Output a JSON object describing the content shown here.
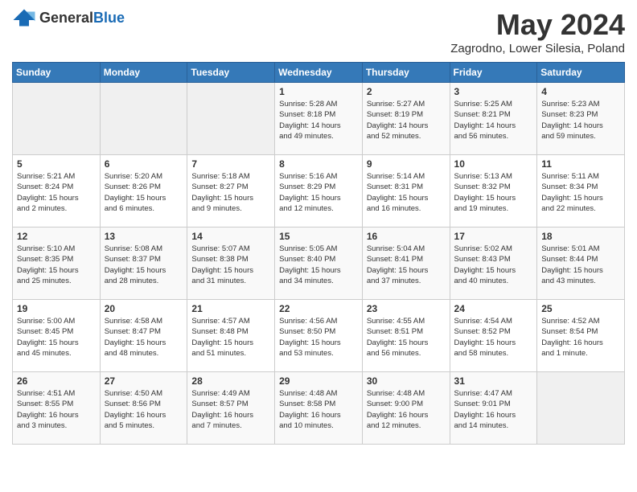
{
  "header": {
    "logo_general": "General",
    "logo_blue": "Blue",
    "month_title": "May 2024",
    "subtitle": "Zagrodno, Lower Silesia, Poland"
  },
  "days_of_week": [
    "Sunday",
    "Monday",
    "Tuesday",
    "Wednesday",
    "Thursday",
    "Friday",
    "Saturday"
  ],
  "weeks": [
    [
      {
        "day": "",
        "info": ""
      },
      {
        "day": "",
        "info": ""
      },
      {
        "day": "",
        "info": ""
      },
      {
        "day": "1",
        "info": "Sunrise: 5:28 AM\nSunset: 8:18 PM\nDaylight: 14 hours\nand 49 minutes."
      },
      {
        "day": "2",
        "info": "Sunrise: 5:27 AM\nSunset: 8:19 PM\nDaylight: 14 hours\nand 52 minutes."
      },
      {
        "day": "3",
        "info": "Sunrise: 5:25 AM\nSunset: 8:21 PM\nDaylight: 14 hours\nand 56 minutes."
      },
      {
        "day": "4",
        "info": "Sunrise: 5:23 AM\nSunset: 8:23 PM\nDaylight: 14 hours\nand 59 minutes."
      }
    ],
    [
      {
        "day": "5",
        "info": "Sunrise: 5:21 AM\nSunset: 8:24 PM\nDaylight: 15 hours\nand 2 minutes."
      },
      {
        "day": "6",
        "info": "Sunrise: 5:20 AM\nSunset: 8:26 PM\nDaylight: 15 hours\nand 6 minutes."
      },
      {
        "day": "7",
        "info": "Sunrise: 5:18 AM\nSunset: 8:27 PM\nDaylight: 15 hours\nand 9 minutes."
      },
      {
        "day": "8",
        "info": "Sunrise: 5:16 AM\nSunset: 8:29 PM\nDaylight: 15 hours\nand 12 minutes."
      },
      {
        "day": "9",
        "info": "Sunrise: 5:14 AM\nSunset: 8:31 PM\nDaylight: 15 hours\nand 16 minutes."
      },
      {
        "day": "10",
        "info": "Sunrise: 5:13 AM\nSunset: 8:32 PM\nDaylight: 15 hours\nand 19 minutes."
      },
      {
        "day": "11",
        "info": "Sunrise: 5:11 AM\nSunset: 8:34 PM\nDaylight: 15 hours\nand 22 minutes."
      }
    ],
    [
      {
        "day": "12",
        "info": "Sunrise: 5:10 AM\nSunset: 8:35 PM\nDaylight: 15 hours\nand 25 minutes."
      },
      {
        "day": "13",
        "info": "Sunrise: 5:08 AM\nSunset: 8:37 PM\nDaylight: 15 hours\nand 28 minutes."
      },
      {
        "day": "14",
        "info": "Sunrise: 5:07 AM\nSunset: 8:38 PM\nDaylight: 15 hours\nand 31 minutes."
      },
      {
        "day": "15",
        "info": "Sunrise: 5:05 AM\nSunset: 8:40 PM\nDaylight: 15 hours\nand 34 minutes."
      },
      {
        "day": "16",
        "info": "Sunrise: 5:04 AM\nSunset: 8:41 PM\nDaylight: 15 hours\nand 37 minutes."
      },
      {
        "day": "17",
        "info": "Sunrise: 5:02 AM\nSunset: 8:43 PM\nDaylight: 15 hours\nand 40 minutes."
      },
      {
        "day": "18",
        "info": "Sunrise: 5:01 AM\nSunset: 8:44 PM\nDaylight: 15 hours\nand 43 minutes."
      }
    ],
    [
      {
        "day": "19",
        "info": "Sunrise: 5:00 AM\nSunset: 8:45 PM\nDaylight: 15 hours\nand 45 minutes."
      },
      {
        "day": "20",
        "info": "Sunrise: 4:58 AM\nSunset: 8:47 PM\nDaylight: 15 hours\nand 48 minutes."
      },
      {
        "day": "21",
        "info": "Sunrise: 4:57 AM\nSunset: 8:48 PM\nDaylight: 15 hours\nand 51 minutes."
      },
      {
        "day": "22",
        "info": "Sunrise: 4:56 AM\nSunset: 8:50 PM\nDaylight: 15 hours\nand 53 minutes."
      },
      {
        "day": "23",
        "info": "Sunrise: 4:55 AM\nSunset: 8:51 PM\nDaylight: 15 hours\nand 56 minutes."
      },
      {
        "day": "24",
        "info": "Sunrise: 4:54 AM\nSunset: 8:52 PM\nDaylight: 15 hours\nand 58 minutes."
      },
      {
        "day": "25",
        "info": "Sunrise: 4:52 AM\nSunset: 8:54 PM\nDaylight: 16 hours\nand 1 minute."
      }
    ],
    [
      {
        "day": "26",
        "info": "Sunrise: 4:51 AM\nSunset: 8:55 PM\nDaylight: 16 hours\nand 3 minutes."
      },
      {
        "day": "27",
        "info": "Sunrise: 4:50 AM\nSunset: 8:56 PM\nDaylight: 16 hours\nand 5 minutes."
      },
      {
        "day": "28",
        "info": "Sunrise: 4:49 AM\nSunset: 8:57 PM\nDaylight: 16 hours\nand 7 minutes."
      },
      {
        "day": "29",
        "info": "Sunrise: 4:48 AM\nSunset: 8:58 PM\nDaylight: 16 hours\nand 10 minutes."
      },
      {
        "day": "30",
        "info": "Sunrise: 4:48 AM\nSunset: 9:00 PM\nDaylight: 16 hours\nand 12 minutes."
      },
      {
        "day": "31",
        "info": "Sunrise: 4:47 AM\nSunset: 9:01 PM\nDaylight: 16 hours\nand 14 minutes."
      },
      {
        "day": "",
        "info": ""
      }
    ]
  ]
}
